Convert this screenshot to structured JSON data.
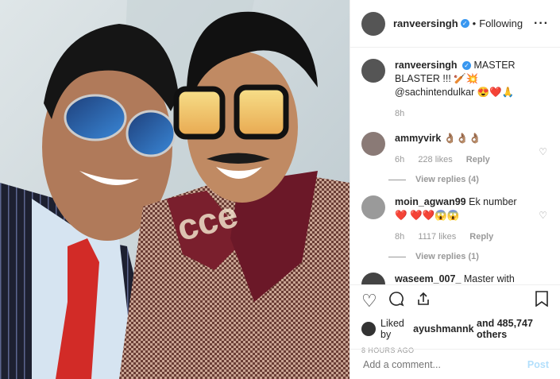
{
  "header": {
    "username": "ranveersingh",
    "verified_badge": "✓",
    "separator": "•",
    "follow_status": "Following",
    "more_label": "···"
  },
  "caption": {
    "username": "ranveersingh",
    "text": "MASTER BLASTER !!! 🏏💥@sachintendulkar 😍❤️🙏",
    "time": "8h"
  },
  "comments": [
    {
      "username": "ammyvirk",
      "text": "👌🏽👌🏽👌🏽",
      "time": "6h",
      "likes": "228 likes",
      "reply": "Reply",
      "view_replies": "View replies (4)"
    },
    {
      "username": "moin_agwan99",
      "text": "Ek number ❤️ ❤️❤️😱😱",
      "time": "8h",
      "likes": "1117 likes",
      "reply": "Reply",
      "view_replies": "View replies (1)"
    },
    {
      "username": "waseem_007_",
      "text": "Master with blaster so much fun😍😍😍😍",
      "time": "",
      "likes": "",
      "reply": "",
      "view_replies": ""
    }
  ],
  "likes": {
    "text_prefix": "Liked by",
    "liked_by": "ayushmannk",
    "text_suffix": "and 485,747 others"
  },
  "time_ago": "8 hours ago",
  "add_comment": {
    "placeholder": "Add a comment...",
    "post_label": "Post"
  },
  "icons": {
    "heart": "heart-icon",
    "comment": "comment-icon",
    "share": "share-icon",
    "save": "bookmark-icon"
  }
}
